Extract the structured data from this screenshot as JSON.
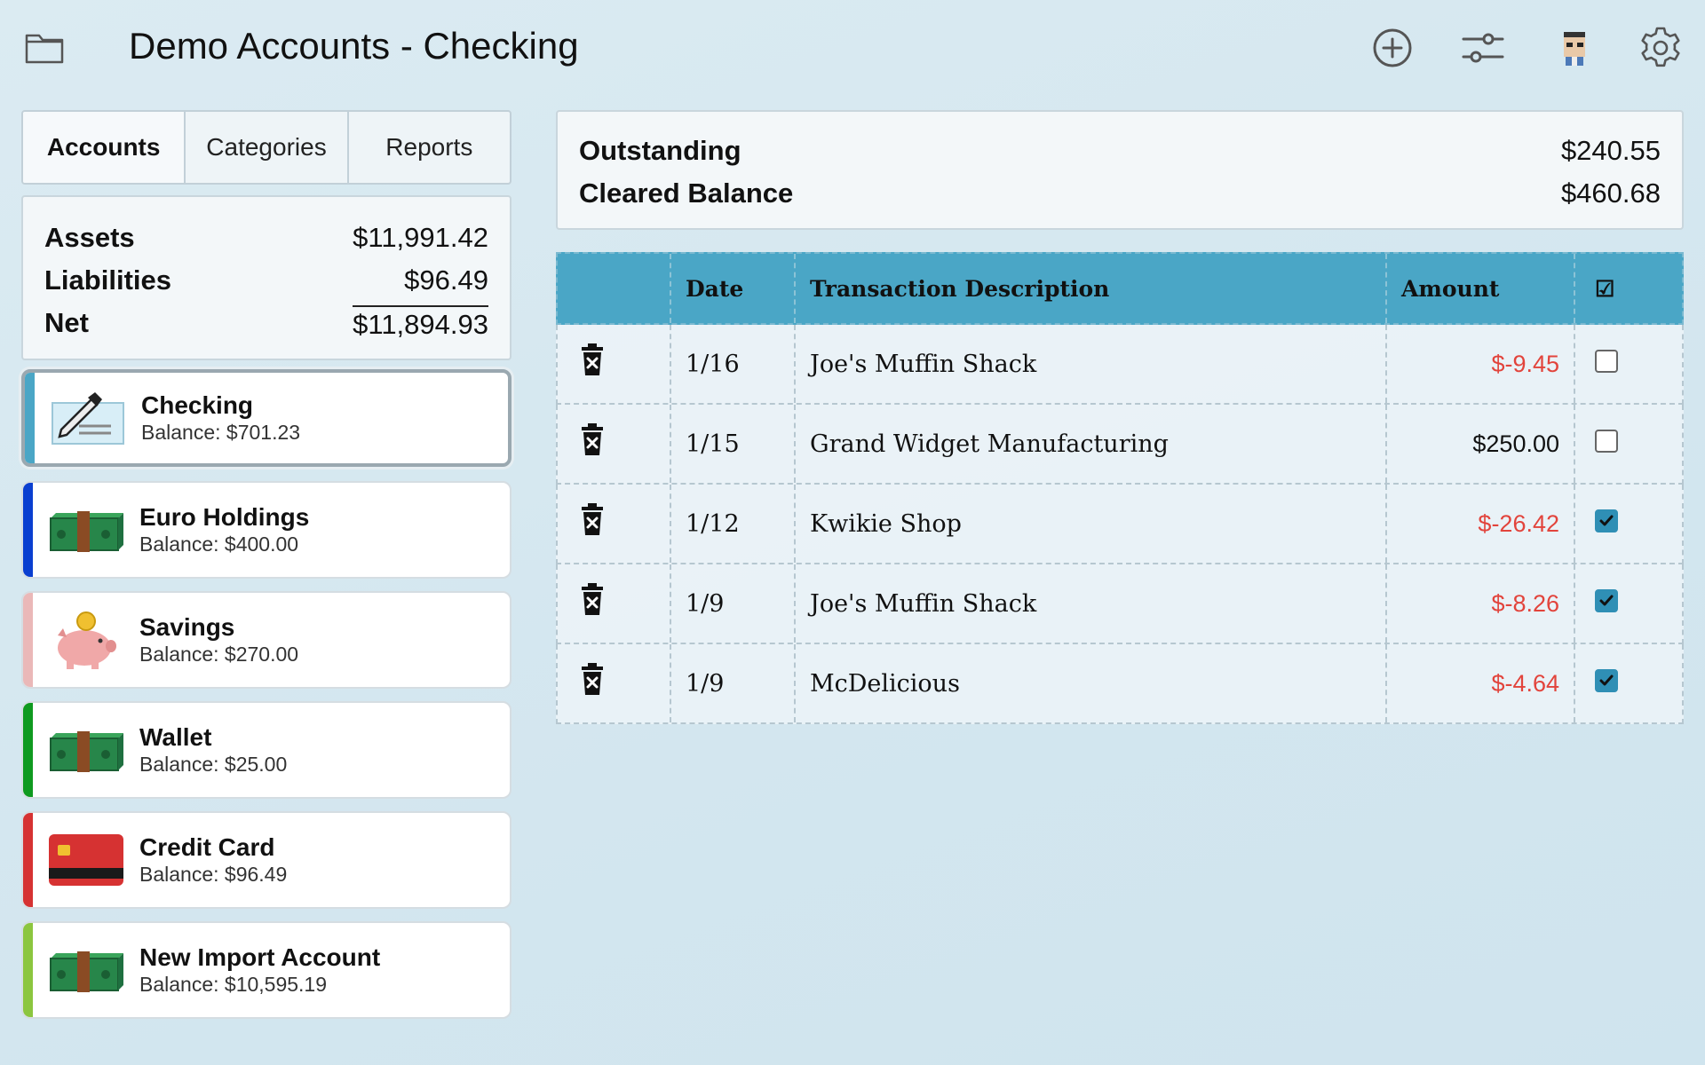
{
  "header": {
    "title": "Demo Accounts - Checking",
    "icons": [
      "folder-icon",
      "add-icon",
      "sliders-icon",
      "avatar",
      "gear-icon"
    ]
  },
  "tabs": [
    {
      "label": "Accounts",
      "active": true
    },
    {
      "label": "Categories",
      "active": false
    },
    {
      "label": "Reports",
      "active": false
    }
  ],
  "summary": {
    "assets_label": "Assets",
    "assets": "$11,991.42",
    "liabilities_label": "Liabilities",
    "liabilities": "$96.49",
    "net_label": "Net",
    "net": "$11,894.93"
  },
  "accounts": [
    {
      "name": "Checking",
      "balance": "Balance: $701.23",
      "color": "#4aa6c6",
      "icon": "check-icon",
      "selected": true
    },
    {
      "name": "Euro Holdings",
      "balance": "Balance: $400.00",
      "color": "#0a3fd0",
      "icon": "cash-icon"
    },
    {
      "name": "Savings",
      "balance": "Balance: $270.00",
      "color": "#eab8b8",
      "icon": "piggy-bank-icon"
    },
    {
      "name": "Wallet",
      "balance": "Balance: $25.00",
      "color": "#0f9a1f",
      "icon": "cash-icon"
    },
    {
      "name": "Credit Card",
      "balance": "Balance: $96.49",
      "color": "#d63232",
      "icon": "credit-card-icon"
    },
    {
      "name": "New Import Account",
      "balance": "Balance: $10,595.19",
      "color": "#8cc63f",
      "icon": "cash-icon"
    }
  ],
  "outstanding": {
    "outstanding_label": "Outstanding",
    "outstanding": "$240.55",
    "cleared_label": "Cleared Balance",
    "cleared": "$460.68"
  },
  "table": {
    "headers": {
      "date": "Date",
      "description": "Transaction Description",
      "amount": "Amount",
      "check": "☑"
    },
    "rows": [
      {
        "date": "1/16",
        "description": "Joe's Muffin Shack",
        "amount": "$-9.45",
        "negative": true,
        "cleared": false
      },
      {
        "date": "1/15",
        "description": "Grand Widget Manufacturing",
        "amount": "$250.00",
        "negative": false,
        "cleared": false
      },
      {
        "date": "1/12",
        "description": "Kwikie Shop",
        "amount": "$-26.42",
        "negative": true,
        "cleared": true
      },
      {
        "date": "1/9",
        "description": "Joe's Muffin Shack",
        "amount": "$-8.26",
        "negative": true,
        "cleared": true
      },
      {
        "date": "1/9",
        "description": "McDelicious",
        "amount": "$-4.64",
        "negative": true,
        "cleared": true
      }
    ]
  },
  "colors": {
    "accent": "#4aa6c6",
    "negative": "#e2443c",
    "checkbox_on": "#2f8fb5"
  }
}
